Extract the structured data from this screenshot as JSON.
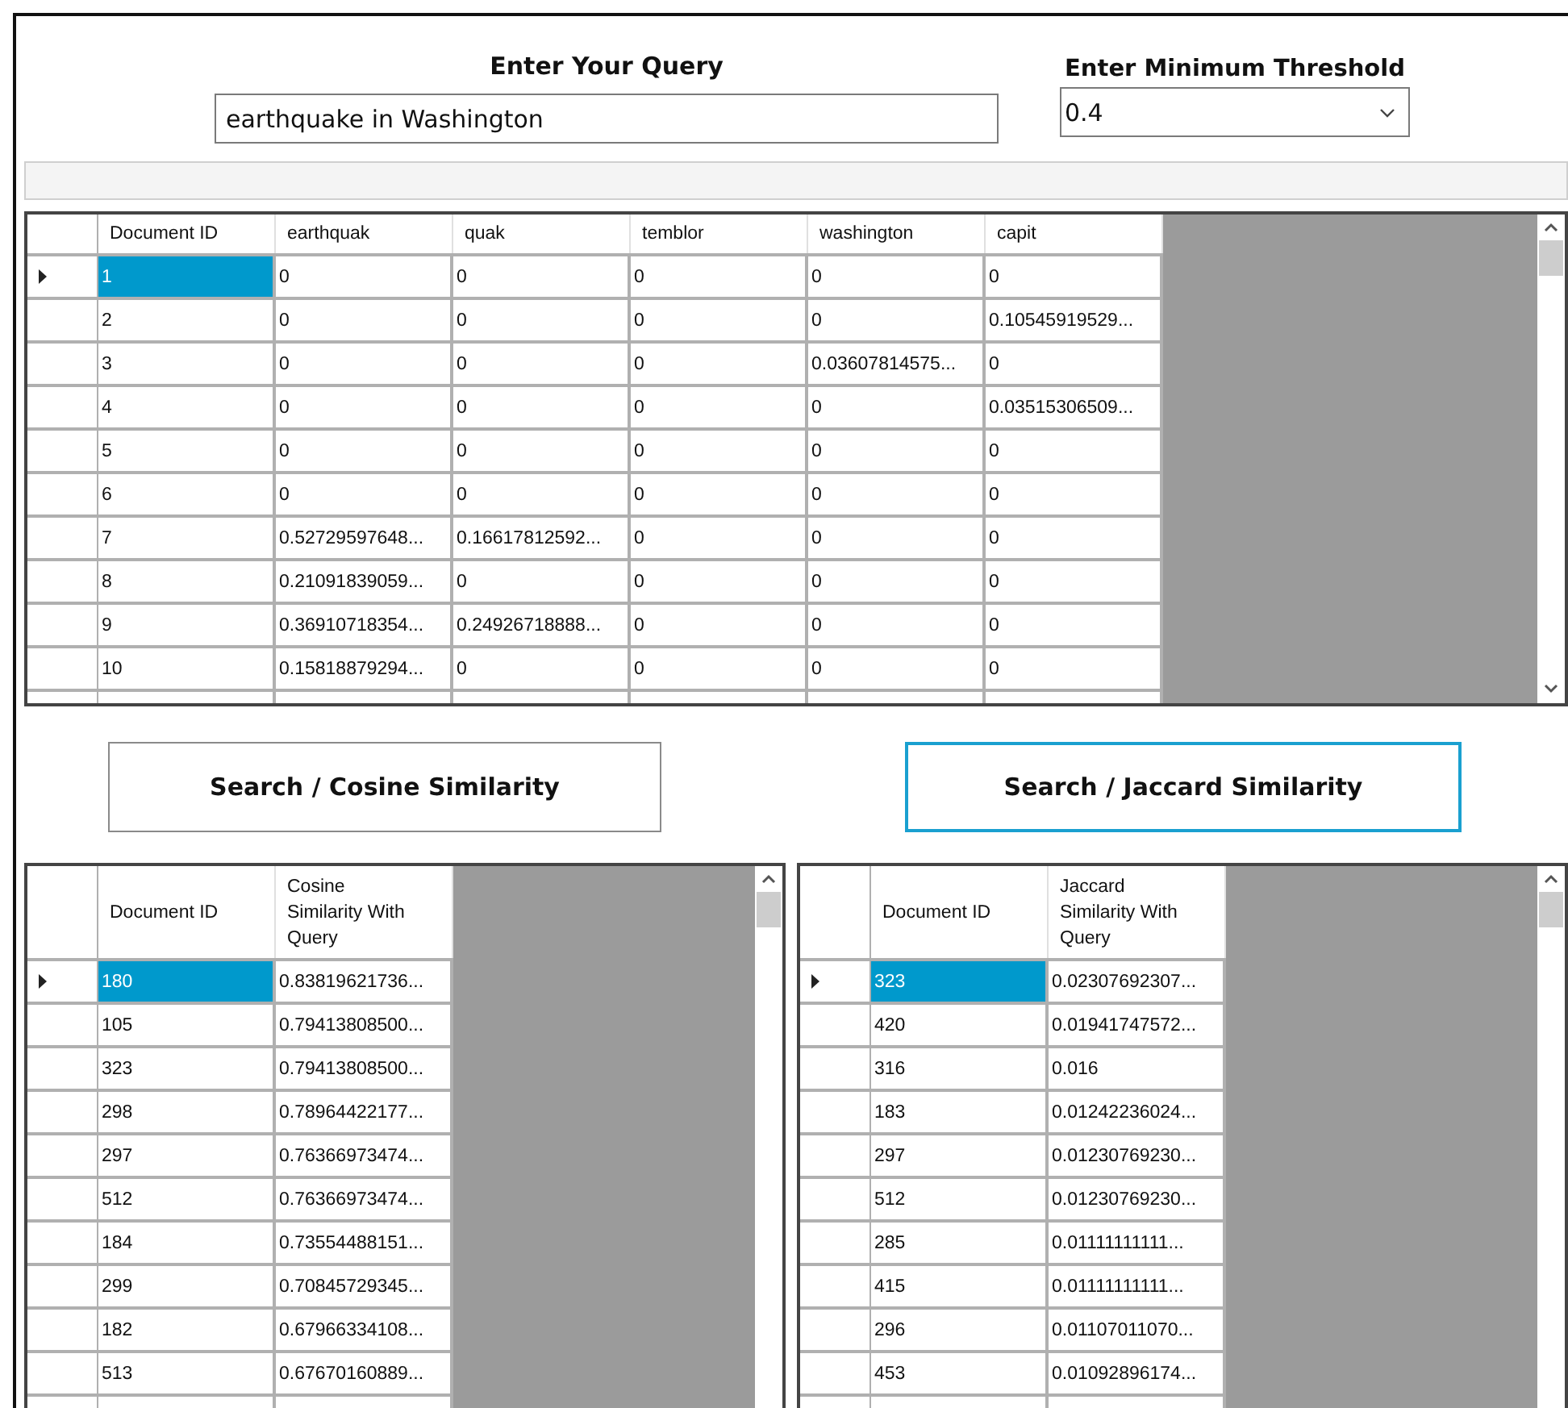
{
  "query": {
    "label": "Enter Your Query",
    "value": "earthquake in Washington"
  },
  "threshold": {
    "label": "Enter Minimum Threshold",
    "value": "0.4"
  },
  "features_table": {
    "columns": [
      "Document ID",
      "earthquak",
      "quak",
      "temblor",
      "washington",
      "capit"
    ],
    "rows": [
      {
        "selected": true,
        "cells": [
          "1",
          "0",
          "0",
          "0",
          "0",
          "0"
        ]
      },
      {
        "selected": false,
        "cells": [
          "2",
          "0",
          "0",
          "0",
          "0",
          "0.10545919529..."
        ]
      },
      {
        "selected": false,
        "cells": [
          "3",
          "0",
          "0",
          "0",
          "0.03607814575...",
          "0"
        ]
      },
      {
        "selected": false,
        "cells": [
          "4",
          "0",
          "0",
          "0",
          "0",
          "0.03515306509..."
        ]
      },
      {
        "selected": false,
        "cells": [
          "5",
          "0",
          "0",
          "0",
          "0",
          "0"
        ]
      },
      {
        "selected": false,
        "cells": [
          "6",
          "0",
          "0",
          "0",
          "0",
          "0"
        ]
      },
      {
        "selected": false,
        "cells": [
          "7",
          "0.52729597648...",
          "0.16617812592...",
          "0",
          "0",
          "0"
        ]
      },
      {
        "selected": false,
        "cells": [
          "8",
          "0.21091839059...",
          "0",
          "0",
          "0",
          "0"
        ]
      },
      {
        "selected": false,
        "cells": [
          "9",
          "0.36910718354...",
          "0.24926718888...",
          "0",
          "0",
          "0"
        ]
      },
      {
        "selected": false,
        "cells": [
          "10",
          "0.15818879294...",
          "0",
          "0",
          "0",
          "0"
        ]
      }
    ]
  },
  "buttons": [
    {
      "label": "Search / Cosine Similarity",
      "focused": false
    },
    {
      "label": "Search / Jaccard Similarity",
      "focused": true
    }
  ],
  "results": [
    {
      "columns": [
        "Document ID",
        "Cosine Similarity With Query"
      ],
      "rows": [
        {
          "selected": true,
          "cells": [
            "180",
            "0.83819621736..."
          ]
        },
        {
          "selected": false,
          "cells": [
            "105",
            "0.79413808500..."
          ]
        },
        {
          "selected": false,
          "cells": [
            "323",
            "0.79413808500..."
          ]
        },
        {
          "selected": false,
          "cells": [
            "298",
            "0.78964422177..."
          ]
        },
        {
          "selected": false,
          "cells": [
            "297",
            "0.76366973474..."
          ]
        },
        {
          "selected": false,
          "cells": [
            "512",
            "0.76366973474..."
          ]
        },
        {
          "selected": false,
          "cells": [
            "184",
            "0.73554488151..."
          ]
        },
        {
          "selected": false,
          "cells": [
            "299",
            "0.70845729345..."
          ]
        },
        {
          "selected": false,
          "cells": [
            "182",
            "0.67966334108..."
          ]
        },
        {
          "selected": false,
          "cells": [
            "513",
            "0.67670160889..."
          ]
        }
      ]
    },
    {
      "columns": [
        "Document ID",
        "Jaccard Similarity With Query"
      ],
      "rows": [
        {
          "selected": true,
          "cells": [
            "323",
            "0.02307692307..."
          ]
        },
        {
          "selected": false,
          "cells": [
            "420",
            "0.01941747572..."
          ]
        },
        {
          "selected": false,
          "cells": [
            "316",
            "0.016"
          ]
        },
        {
          "selected": false,
          "cells": [
            "183",
            "0.01242236024..."
          ]
        },
        {
          "selected": false,
          "cells": [
            "297",
            "0.01230769230..."
          ]
        },
        {
          "selected": false,
          "cells": [
            "512",
            "0.01230769230..."
          ]
        },
        {
          "selected": false,
          "cells": [
            "285",
            "0.01111111111..."
          ]
        },
        {
          "selected": false,
          "cells": [
            "415",
            "0.01111111111..."
          ]
        },
        {
          "selected": false,
          "cells": [
            "296",
            "0.01107011070..."
          ]
        },
        {
          "selected": false,
          "cells": [
            "453",
            "0.01092896174..."
          ]
        }
      ]
    }
  ]
}
